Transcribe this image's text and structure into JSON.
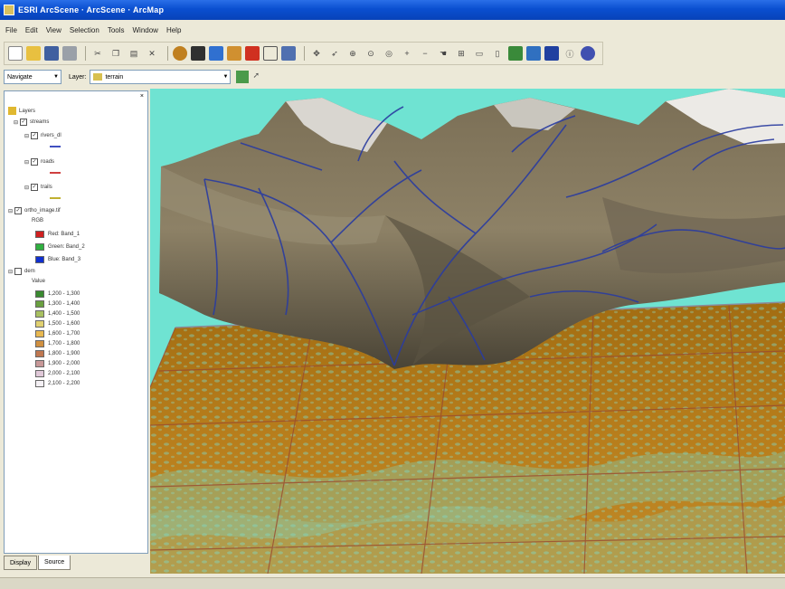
{
  "window": {
    "title": "ESRI ArcScene · ArcScene · ArcMap"
  },
  "menu": [
    "File",
    "Edit",
    "View",
    "Selection",
    "Tools",
    "Window",
    "Help"
  ],
  "toolbar2": {
    "dropdown1": "Navigate",
    "layer_label": "Layer:",
    "layer_value": "terrain"
  },
  "toc": {
    "root": "Layers",
    "layers": [
      {
        "name": "streams",
        "sub": [
          {
            "name": "rivers_dl",
            "color": "#4050c0"
          }
        ]
      },
      {
        "name": "roads",
        "sub": [
          {
            "name": "roads",
            "color": "#d04040"
          }
        ]
      },
      {
        "name": "trails",
        "sub": [
          {
            "name": "trails",
            "color": "#c0b030"
          }
        ]
      },
      {
        "name": "ortho_image.tif",
        "label": "RGB",
        "bands": [
          {
            "label": "Red: Band_1",
            "color": "#d02020"
          },
          {
            "label": "Green: Band_2",
            "color": "#30b040"
          },
          {
            "label": "Blue: Band_3",
            "color": "#1030d0"
          }
        ]
      },
      {
        "name": "dem",
        "label": "Value",
        "classes": [
          {
            "label": "1,200 - 1,300",
            "color": "#3a8a30"
          },
          {
            "label": "1,300 - 1,400",
            "color": "#6aa040"
          },
          {
            "label": "1,400 - 1,500",
            "color": "#a8c060"
          },
          {
            "label": "1,500 - 1,600",
            "color": "#e0d070"
          },
          {
            "label": "1,600 - 1,700",
            "color": "#e8b850"
          },
          {
            "label": "1,700 - 1,800",
            "color": "#d09040"
          },
          {
            "label": "1,800 - 1,900",
            "color": "#c07850"
          },
          {
            "label": "1,900 - 2,000",
            "color": "#c89898"
          },
          {
            "label": "2,000 - 2,100",
            "color": "#e0c8d8"
          },
          {
            "label": "2,100 - 2,200",
            "color": "#f4f0f4"
          }
        ]
      }
    ]
  },
  "toc_tabs": [
    "Display",
    "Source"
  ],
  "colors": {
    "sky": "#6fe3d2",
    "terrain": "#8a7d62",
    "plane": "#b07a18",
    "streams": "#2a3ca0"
  }
}
